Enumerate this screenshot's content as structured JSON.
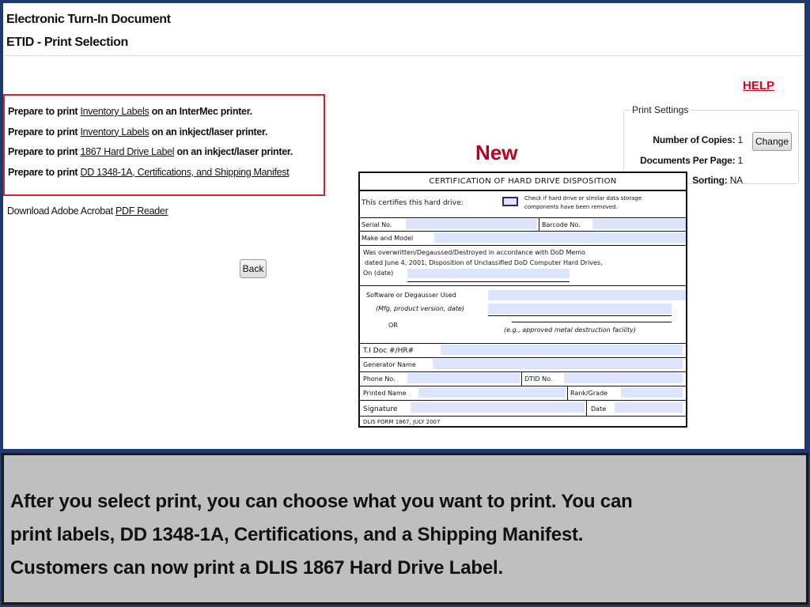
{
  "header": {
    "title": "Electronic Turn-In Document",
    "subtitle": "ETID - Print Selection"
  },
  "help_label": "HELP",
  "print_options": [
    {
      "prefix": "Prepare to print",
      "link": "Inventory Labels",
      "suffix": "on an InterMec printer."
    },
    {
      "prefix": "Prepare to print",
      "link": "Inventory Labels",
      "suffix": "on an inkject/laser printer."
    },
    {
      "prefix": "Prepare to print",
      "link": "1867 Hard Drive Label",
      "suffix": "on an inkject/laser printer."
    },
    {
      "prefix": "Prepare to print",
      "link": "DD 1348-1A, Certifications, and Shipping Manifest",
      "suffix": ""
    }
  ],
  "download": {
    "text": "Download Adobe Acrobat",
    "link": "PDF Reader"
  },
  "back_label": "Back",
  "new_label": "New",
  "print_settings": {
    "legend": "Print Settings",
    "copies_label": "Number of Copies:",
    "copies_value": "1",
    "per_page_label": "Documents Per Page:",
    "per_page_value": "1",
    "sorting_label": "Sorting:",
    "sorting_value": "NA",
    "change_label": "Change"
  },
  "form": {
    "title": "CERTIFICATION OF HARD DRIVE DISPOSITION",
    "certifies": "This certifies this hard drive:",
    "check_note_1": "Check if hard drive or similar data storage",
    "check_note_2": "components have been removed.",
    "serial": "Serial No.",
    "barcode": "Barcode No.",
    "make_model": "Make and Model",
    "overwritten_1": "Was overwritten/Degaussed/Destroyed in accordance  with DoD Memo",
    "overwritten_2": "dated June 4, 2001, Disposition of Unclassified DoD Computer Hard Drives,",
    "overwritten_3": "On (date)",
    "software": "Software or Degausser Used",
    "mfg": "(Mfg, product version, date)",
    "or": "OR",
    "eg": "(e.g., approved metal destruction facility)",
    "ti_doc": "T.I Doc #/HR#",
    "generator": "Generator Name",
    "phone": "Phone No.",
    "dtid": "DTID No.",
    "printed_name": "Printed Name",
    "rank": "Rank/Grade",
    "signature": "Signature",
    "date": "Date",
    "form_id": "DLIS FORM  1867, JULY 2007"
  },
  "caption": {
    "line1": "After you select print, you can choose what you want to print.  You can",
    "line2": "print labels, DD 1348-1A, Certifications, and a Shipping Manifest.",
    "line3": "Customers can now print a DLIS 1867 Hard Drive Label."
  },
  "colors": {
    "frame": "#1f3a6e",
    "highlight_border": "#d8202a",
    "accent_red": "#c0001a",
    "form_fill": "#dde4ff",
    "caption_bg": "#bfbfbf"
  }
}
